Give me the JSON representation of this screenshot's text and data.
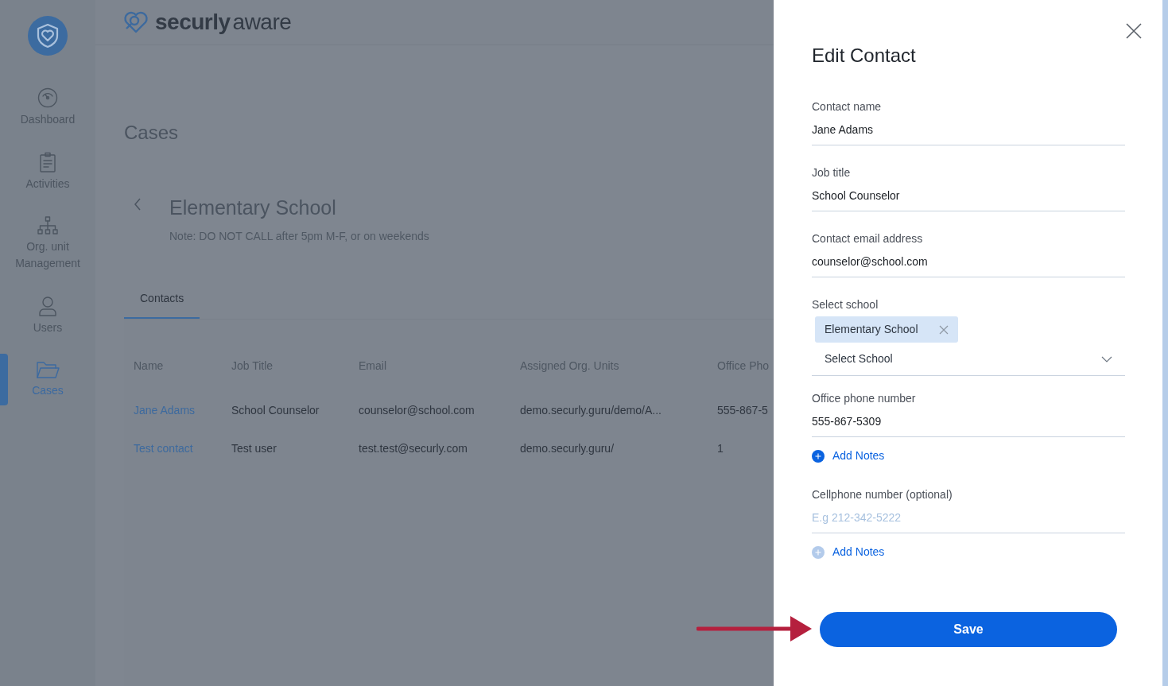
{
  "sidebar": {
    "items": [
      {
        "label": "Dashboard",
        "selected": false
      },
      {
        "label": "Activities",
        "selected": false
      },
      {
        "label": "Org. unit Management",
        "selected": false
      },
      {
        "label": "Users",
        "selected": false
      },
      {
        "label": "Cases",
        "selected": true
      }
    ]
  },
  "header": {
    "brand_bold": "securly",
    "brand_light": "aware"
  },
  "page": {
    "title": "Cases",
    "case_title": "Elementary School",
    "note": "Note: DO NOT CALL after 5pm M-F, or on weekends",
    "tabs": [
      {
        "label": "Contacts",
        "selected": true
      }
    ],
    "table": {
      "columns": [
        "Name",
        "Job Title",
        "Email",
        "Assigned Org. Units",
        "Office Pho"
      ],
      "rows": [
        [
          "Jane Adams",
          "School Counselor",
          "counselor@school.com",
          "demo.securly.guru/demo/A...",
          "555-867-5"
        ],
        [
          "Test contact",
          "Test user",
          "test.test@securly.com",
          "demo.securly.guru/",
          "1"
        ]
      ]
    }
  },
  "drawer": {
    "title": "Edit Contact",
    "fields": [
      {
        "kind": "text",
        "label": "Contact name",
        "value": "Jane Adams"
      },
      {
        "kind": "text",
        "label": "Job title",
        "value": "School Counselor"
      },
      {
        "kind": "text",
        "label": "Contact email address",
        "value": "counselor@school.com"
      },
      {
        "kind": "select",
        "label": "Select school",
        "chips": [
          "Elementary School"
        ],
        "placeholder": "Select School"
      },
      {
        "kind": "text",
        "label": "Office phone number",
        "value": "555-867-5309",
        "notes": {
          "label": "Add Notes",
          "disabled": false
        }
      },
      {
        "kind": "text",
        "label": "Cellphone number (optional)",
        "placeholder": "E.g 212-342-5222",
        "notes": {
          "label": "Add Notes",
          "disabled": true
        }
      }
    ],
    "save": "Save"
  }
}
